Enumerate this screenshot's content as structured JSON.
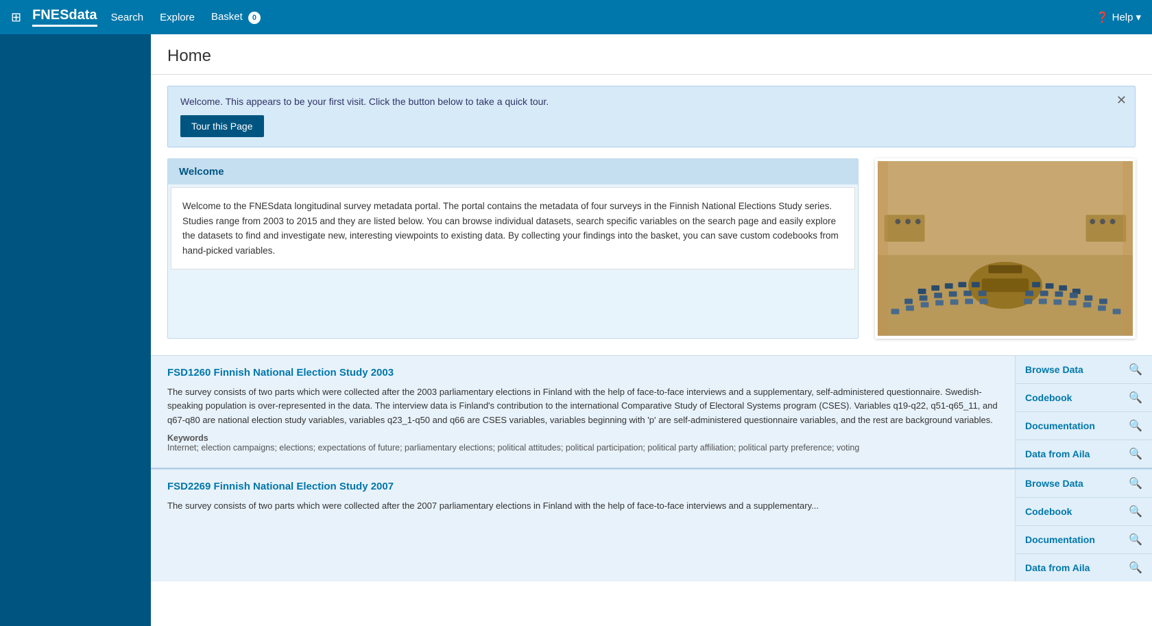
{
  "navbar": {
    "brand": "FNESdata",
    "icons": [
      "grid-icon"
    ],
    "links": [
      {
        "label": "Search",
        "badge": null
      },
      {
        "label": "Explore",
        "badge": null
      },
      {
        "label": "Basket",
        "badge": "0"
      }
    ],
    "help_label": "Help"
  },
  "page": {
    "title": "Home"
  },
  "tour_banner": {
    "message": "Welcome. This appears to be your first visit. Click the button below to take a quick tour.",
    "button_label": "Tour this Page"
  },
  "welcome": {
    "heading": "Welcome",
    "body": "Welcome to the FNESdata longitudinal survey metadata portal. The portal contains the metadata of four surveys in the Finnish National Elections Study series. Studies range from 2003 to 2015 and they are listed below. You can browse individual datasets, search specific variables on the search page and easily explore the datasets to find and investigate new, interesting viewpoints to existing data. By collecting your findings into the basket, you can save custom codebooks from hand-picked variables."
  },
  "datasets": [
    {
      "id": "fsd1260",
      "title": "FSD1260 Finnish National Election Study 2003",
      "description": "The survey consists of two parts which were collected after the 2003 parliamentary elections in Finland with the help of face-to-face interviews and a supplementary, self-administered questionnaire. Swedish-speaking population is over-represented in the data. The interview data is Finland's contribution to the international Comparative Study of Electoral Systems program (CSES). Variables q19-q22, q51-q65_11, and q67-q80 are national election study variables, variables q23_1-q50 and q66 are CSES variables, variables beginning with 'p' are self-administered questionnaire variables, and the rest are background variables.",
      "keywords_label": "Keywords",
      "keywords": "Internet; election campaigns; elections; expectations of future; parliamentary elections; political attitudes; political participation; political party affiliation; political party preference; voting",
      "actions": [
        {
          "label": "Browse Data"
        },
        {
          "label": "Codebook"
        },
        {
          "label": "Documentation"
        },
        {
          "label": "Data from Aila"
        }
      ]
    },
    {
      "id": "fsd2269",
      "title": "FSD2269 Finnish National Election Study 2007",
      "description": "The survey consists of two parts which were collected after the 2007 parliamentary elections in Finland with the help of face-to-face interviews and a supplementary...",
      "keywords_label": "",
      "keywords": "",
      "actions": [
        {
          "label": "Browse Data"
        },
        {
          "label": "Codebook"
        },
        {
          "label": "Documentation"
        },
        {
          "label": "Data from Aila"
        }
      ]
    }
  ]
}
